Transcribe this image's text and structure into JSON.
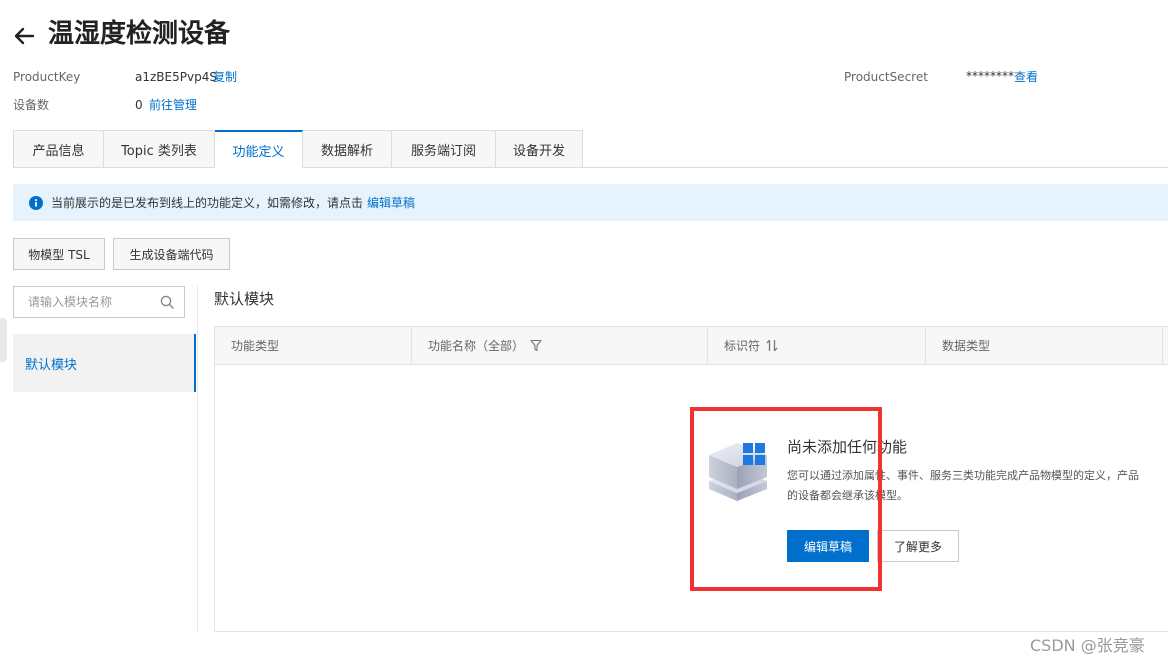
{
  "header": {
    "title": "温湿度检测设备"
  },
  "meta": {
    "product_key_label": "ProductKey",
    "product_key_value": "a1zBE5Pvp4S",
    "copy_link": "复制",
    "product_secret_label": "ProductSecret",
    "product_secret_value": "********",
    "view_link": "查看",
    "device_count_label": "设备数",
    "device_count_value": "0",
    "manage_link": "前往管理"
  },
  "tabs": [
    {
      "label": "产品信息"
    },
    {
      "label": "Topic 类列表"
    },
    {
      "label": "功能定义"
    },
    {
      "label": "数据解析"
    },
    {
      "label": "服务端订阅"
    },
    {
      "label": "设备开发"
    }
  ],
  "banner": {
    "text": "当前展示的是已发布到线上的功能定义，如需修改，请点击",
    "link": "编辑草稿"
  },
  "toolbar": {
    "tsl_button": "物模型 TSL",
    "gen_code_button": "生成设备端代码"
  },
  "sidebar": {
    "search_placeholder": "请输入模块名称",
    "items": [
      {
        "label": "默认模块"
      }
    ]
  },
  "main": {
    "module_title": "默认模块",
    "columns": [
      "功能类型",
      "功能名称（全部）",
      "标识符",
      "数据类型"
    ],
    "empty": {
      "title": "尚未添加任何功能",
      "desc_line1": "您可以通过添加属性、事件、服务三类功能完成产品物模型的定义，产品",
      "desc_line2": "的设备都会继承该模型。",
      "primary_button": "编辑草稿",
      "secondary_button": "了解更多"
    }
  },
  "watermark": "CSDN @张竞豪",
  "colors": {
    "accent": "#0070cc",
    "highlight": "#f03232",
    "banner_bg": "#e6f3fc"
  }
}
